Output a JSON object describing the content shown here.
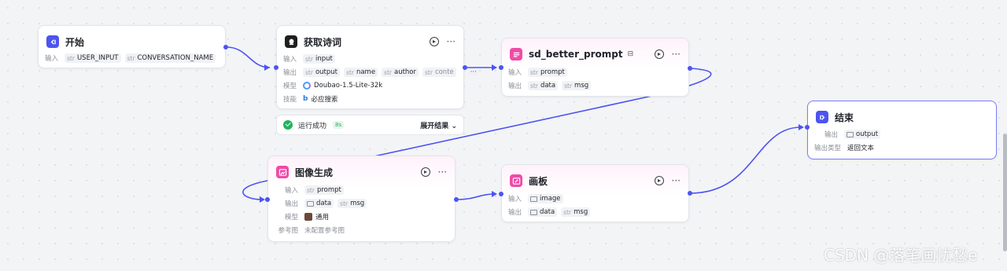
{
  "labels": {
    "input": "输入",
    "output": "输出",
    "model": "模型",
    "skill": "技能",
    "ref_image": "参考图",
    "output_type": "输出类型",
    "type_str": "str"
  },
  "nodes": {
    "start": {
      "title": "开始",
      "inputs": [
        "USER_INPUT",
        "CONVERSATION_NAME"
      ]
    },
    "poem": {
      "title": "获取诗词",
      "inputs": [
        "input"
      ],
      "outputs": [
        "output",
        "name",
        "author",
        "conte"
      ],
      "more": "···",
      "model": "Doubao-1.5-Lite-32k",
      "skill": "必应搜索"
    },
    "status": {
      "text": "运行成功",
      "time": "8s",
      "expand": "展开结果"
    },
    "sd": {
      "title": "sd_better_prompt",
      "inputs": [
        "prompt"
      ],
      "outputs": [
        "data",
        "msg"
      ]
    },
    "imagegen": {
      "title": "图像生成",
      "inputs": [
        "prompt"
      ],
      "outputs": [
        "data",
        "msg"
      ],
      "model": "通用",
      "ref": "未配置参考图"
    },
    "canvas": {
      "title": "画板",
      "inputs": [
        "image"
      ],
      "outputs": [
        "data",
        "msg"
      ]
    },
    "end": {
      "title": "结束",
      "outputs": [
        "output"
      ],
      "output_type": "返回文本"
    }
  },
  "watermark": "CSDN @落笔画忧愁e",
  "colors": {
    "accent": "#4c54f0",
    "pink": "#f04aa6",
    "success": "#22b35e"
  }
}
